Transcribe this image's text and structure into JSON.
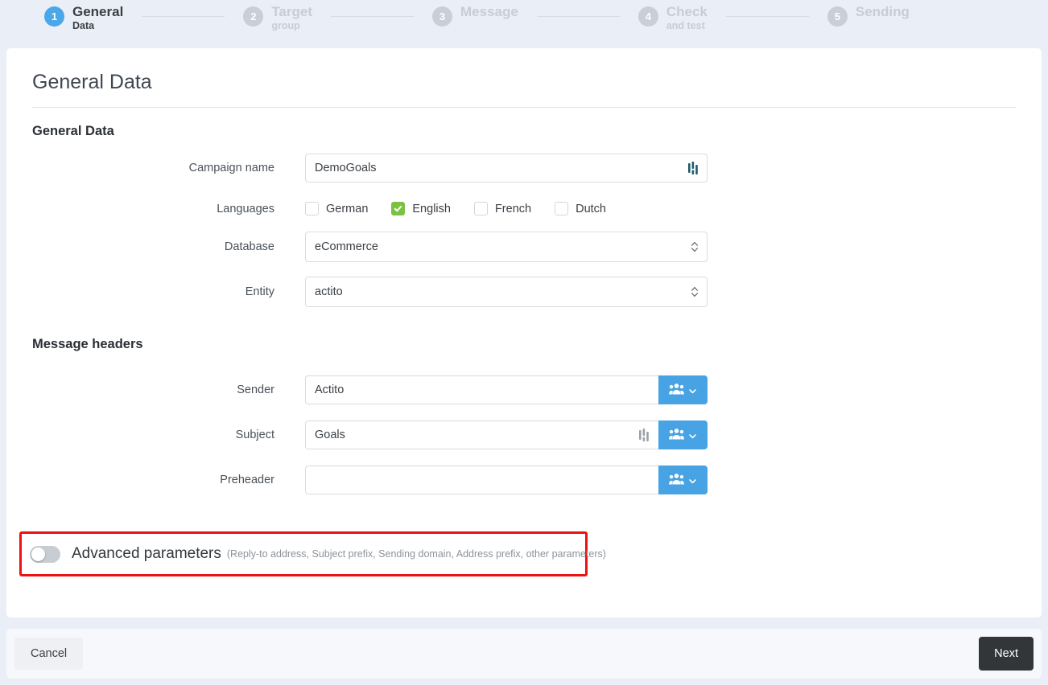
{
  "stepper": {
    "steps": [
      {
        "number": "1",
        "title": "General",
        "sub": "Data",
        "active": true
      },
      {
        "number": "2",
        "title": "Target",
        "sub": "group",
        "active": false
      },
      {
        "number": "3",
        "title": "Message",
        "sub": "",
        "active": false
      },
      {
        "number": "4",
        "title": "Check",
        "sub": "and test",
        "active": false
      },
      {
        "number": "5",
        "title": "Sending",
        "sub": "",
        "active": false
      }
    ],
    "active_color": "#4aa7e8",
    "inactive_color": "#c9ced8"
  },
  "page": {
    "title": "General Data"
  },
  "general_section": {
    "heading": "General Data",
    "campaign_name": {
      "label": "Campaign name",
      "value": "DemoGoals",
      "placeholder": "",
      "icon": "personalization-icon"
    },
    "languages": {
      "label": "Languages",
      "options": [
        {
          "label": "German",
          "checked": false
        },
        {
          "label": "English",
          "checked": true
        },
        {
          "label": "French",
          "checked": false
        },
        {
          "label": "Dutch",
          "checked": false
        }
      ],
      "checked_color": "#7cc242"
    },
    "database": {
      "label": "Database",
      "value": "eCommerce"
    },
    "entity": {
      "label": "Entity",
      "value": "actito"
    }
  },
  "message_headers": {
    "heading": "Message headers",
    "sender": {
      "label": "Sender",
      "value": "Actito",
      "placeholder": "",
      "button_icon": "people-icon",
      "button_chevron": "chevron-down-icon"
    },
    "subject": {
      "label": "Subject",
      "value": "Goals",
      "placeholder": "",
      "inline_icon": "personalization-icon",
      "button_icon": "people-icon",
      "button_chevron": "chevron-down-icon"
    },
    "preheader": {
      "label": "Preheader",
      "value": "",
      "placeholder": "",
      "button_icon": "people-icon",
      "button_chevron": "chevron-down-icon"
    },
    "button_color": "#47a3e3"
  },
  "advanced_parameters": {
    "title": "Advanced parameters",
    "subtitle": "(Reply-to address, Subject prefix, Sending domain, Address prefix, other parameters)",
    "toggle_on": false,
    "highlight_color": "#ee1111"
  },
  "footer": {
    "cancel_label": "Cancel",
    "next_label": "Next",
    "next_color": "#333638"
  }
}
